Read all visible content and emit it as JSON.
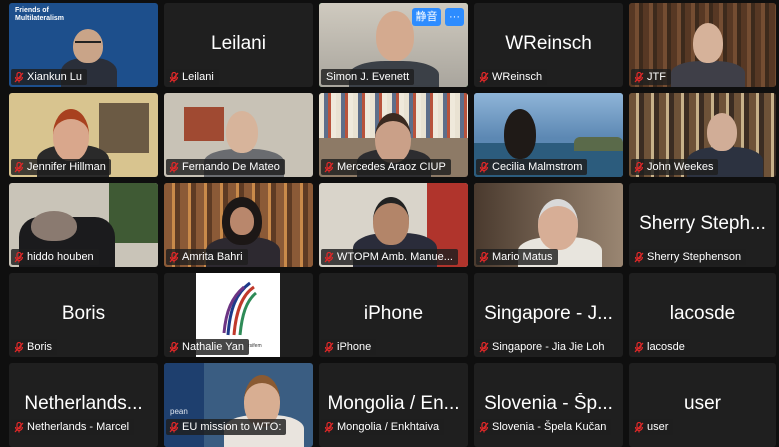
{
  "window": {
    "title": "Zoom meeting gallery view"
  },
  "controls": {
    "mute_label": "静音",
    "more_label": "···"
  },
  "branding": {
    "friends_line1": "Friends of",
    "friends_line2": "Multilateralism",
    "eu_fragment": "pean",
    "nathalie_fragment": "rsifem"
  },
  "colors": {
    "active_speaker": "#2ec35a",
    "muted_icon": "#e02828",
    "accent": "#2d8cff"
  },
  "participants": [
    {
      "name": "Xiankun Lu",
      "tile_title": "",
      "muted": true
    },
    {
      "name": "Leilani",
      "tile_title": "Leilani",
      "muted": true
    },
    {
      "name": "Simon J. Evenett",
      "tile_title": "",
      "muted": false,
      "active": true
    },
    {
      "name": "WReinsch",
      "tile_title": "WReinsch",
      "muted": true
    },
    {
      "name": "JTF",
      "tile_title": "",
      "muted": true
    },
    {
      "name": "Jennifer Hillman",
      "tile_title": "",
      "muted": true
    },
    {
      "name": "Fernando De Mateo",
      "tile_title": "",
      "muted": true
    },
    {
      "name": "Mercedes Araoz CIUP",
      "tile_title": "",
      "muted": true
    },
    {
      "name": "Cecilia Malmstrom",
      "tile_title": "",
      "muted": true
    },
    {
      "name": "John Weekes",
      "tile_title": "",
      "muted": true
    },
    {
      "name": "hiddo houben",
      "tile_title": "",
      "muted": true
    },
    {
      "name": "Amrita Bahri",
      "tile_title": "",
      "muted": true
    },
    {
      "name": "WTOPM Amb. Manue...",
      "tile_title": "",
      "muted": true
    },
    {
      "name": "Mario Matus",
      "tile_title": "",
      "muted": true
    },
    {
      "name": "Sherry Stephenson",
      "tile_title": "Sherry Steph...",
      "muted": true
    },
    {
      "name": "Boris",
      "tile_title": "Boris",
      "muted": true
    },
    {
      "name": "Nathalie Yan",
      "tile_title": "",
      "muted": true
    },
    {
      "name": "iPhone",
      "tile_title": "iPhone",
      "muted": true
    },
    {
      "name": "Singapore - Jia Jie Loh",
      "tile_title": "Singapore - J...",
      "muted": true
    },
    {
      "name": "lacosde",
      "tile_title": "lacosde",
      "muted": true
    },
    {
      "name": "Netherlands - Marcel",
      "tile_title": "Netherlands...",
      "muted": true
    },
    {
      "name": "EU mission to WTO:",
      "tile_title": "",
      "muted": true
    },
    {
      "name": "Mongolia / Enkhtaiva",
      "tile_title": "Mongolia / En...",
      "muted": true
    },
    {
      "name": "Slovenia - Špela Kučan",
      "tile_title": "Slovenia - Šp...",
      "muted": true
    },
    {
      "name": "user",
      "tile_title": "user",
      "muted": true
    }
  ]
}
